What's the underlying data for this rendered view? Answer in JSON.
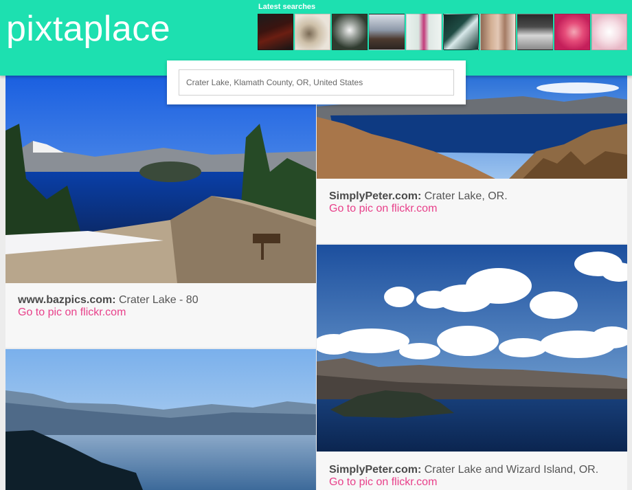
{
  "app": {
    "logo": "pixtaplace"
  },
  "latest": {
    "label": "Latest searches",
    "thumbnails": [
      {
        "icon": "book-cover-thumbnail"
      },
      {
        "icon": "charm-bracelet-thumbnail"
      },
      {
        "icon": "trophy-thumbnail"
      },
      {
        "icon": "city-square-thumbnail"
      },
      {
        "icon": "person-standing-thumbnail"
      },
      {
        "icon": "gymnastics-arena-thumbnail"
      },
      {
        "icon": "yoga-pose-thumbnail"
      },
      {
        "icon": "stage-room-thumbnail"
      },
      {
        "icon": "pink-nails-thumbnail"
      },
      {
        "icon": "nail-art-thumbnail"
      }
    ]
  },
  "search": {
    "value": "Crater Lake, Klamath County, OR, United States",
    "placeholder": "Crater Lake, Klamath County, OR, United States"
  },
  "results": [
    {
      "source": "www.bazpics.com:",
      "title": " Crater Lake - 80",
      "link": "Go to pic on flickr.com",
      "image": "crater-lake-trail-photo"
    },
    {
      "source": "SimplyPeter.com:",
      "title": " Crater Lake, OR.",
      "link": "Go to pic on flickr.com",
      "image": "crater-lake-rim-photo"
    },
    {
      "source": "",
      "title": "",
      "link": "",
      "image": "crater-lake-misty-photo"
    },
    {
      "source": "SimplyPeter.com:",
      "title": " Crater Lake and Wizard Island, OR.",
      "link": "Go to pic on flickr.com",
      "image": "wizard-island-clouds-photo"
    }
  ],
  "colors": {
    "header": "#1de0b0",
    "link": "#e8408a",
    "background": "#ececec",
    "card": "#f7f7f7"
  }
}
